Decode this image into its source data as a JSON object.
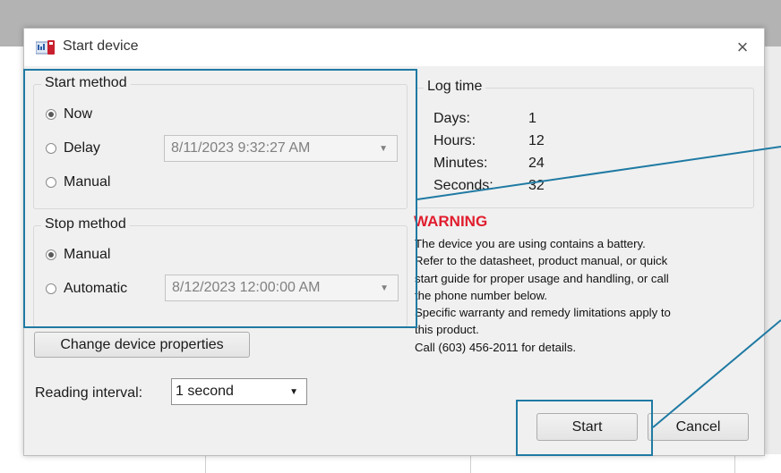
{
  "dialog": {
    "title": "Start device",
    "close_glyph": "×",
    "icon": "device-app-icon"
  },
  "start_method": {
    "label": "Start method",
    "options": [
      "Now",
      "Delay",
      "Manual"
    ],
    "selected": "Now",
    "delay_value": "8/11/2023 9:32:27 AM"
  },
  "stop_method": {
    "label": "Stop method",
    "options": [
      "Manual",
      "Automatic"
    ],
    "selected": "Manual",
    "automatic_value": "8/12/2023 12:00:00 AM"
  },
  "buttons": {
    "change_properties": "Change device properties",
    "start": "Start",
    "cancel": "Cancel"
  },
  "reading_interval": {
    "label": "Reading interval:",
    "value": "1 second"
  },
  "log_time": {
    "label": "Log time",
    "rows": [
      {
        "name": "Days:",
        "value": "1"
      },
      {
        "name": "Hours:",
        "value": "12"
      },
      {
        "name": "Minutes:",
        "value": "24"
      },
      {
        "name": "Seconds:",
        "value": "32"
      }
    ]
  },
  "warning": {
    "title": "WARNING",
    "lines": [
      "The device you are using contains a battery.",
      "Refer to the datasheet, product manual, or quick",
      "start guide for proper usage and handling, or call",
      "the phone number below.",
      "Specific warranty and remedy limitations apply to",
      "this product.",
      "Call (603) 456-2011 for details."
    ]
  },
  "colors": {
    "highlight": "#1f7aa3",
    "warning": "#e11d2e"
  }
}
